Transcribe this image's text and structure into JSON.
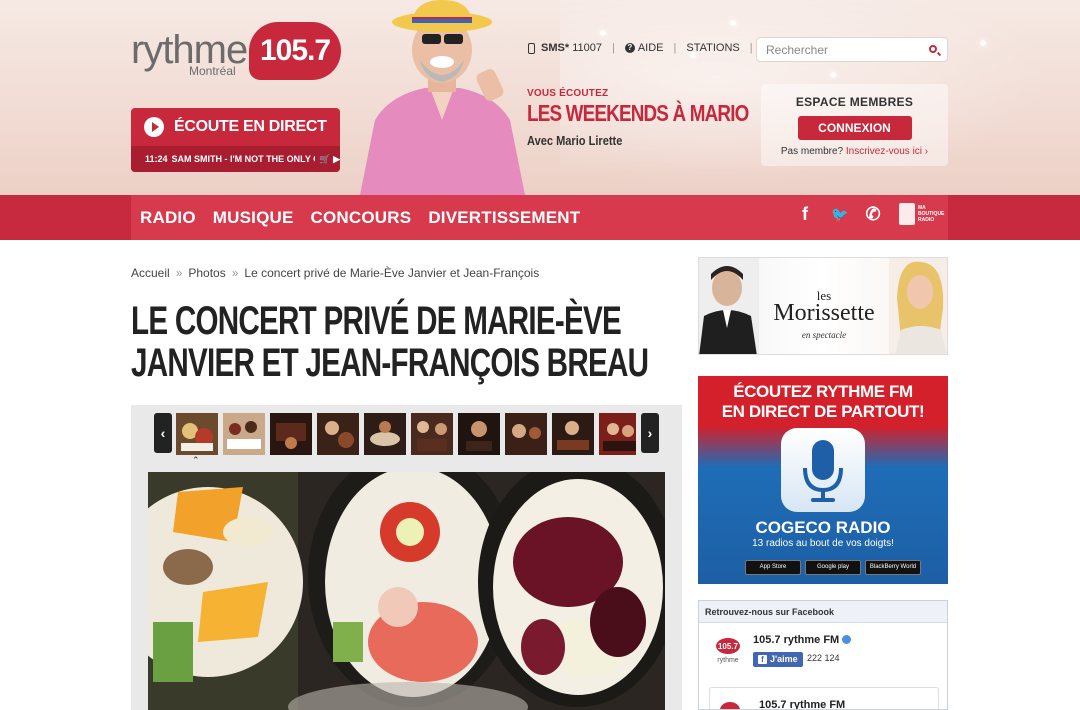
{
  "header": {
    "logo": {
      "word": "rythme",
      "city": "Montréal",
      "frequency": "105.7"
    },
    "listen_live": {
      "label": "ÉCOUTE EN DIRECT",
      "now_playing_time": "11:24",
      "now_playing_track": "SAM SMITH - I'M NOT THE ONLY ONE",
      "icons": "🛒 ▶"
    },
    "show": {
      "kicker": "VOUS ÉCOUTEZ",
      "title": "LES WEEKENDS À MARIO",
      "host": "Avec Mario Lirette"
    },
    "top_links": {
      "sms_label": "SMS*",
      "sms_number": "11007",
      "help": "AIDE",
      "stations": "STATIONS"
    },
    "search": {
      "placeholder": "Rechercher"
    },
    "members": {
      "title": "ESPACE MEMBRES",
      "login_button": "CONNEXION",
      "prompt": "Pas membre?",
      "signup_link": "Inscrivez-vous ici ›"
    }
  },
  "nav": {
    "items": [
      "RADIO",
      "MUSIQUE",
      "CONCOURS",
      "DIVERTISSEMENT"
    ],
    "social": {
      "facebook": "f",
      "twitter": "🐦",
      "phone": "✆"
    },
    "shop_label": "MA BOUTIQUE RADIO"
  },
  "breadcrumb": {
    "home": "Accueil",
    "section": "Photos",
    "current": "Le concert privé de Marie-Ève Janvier et Jean-François"
  },
  "article": {
    "title": "Le concert privé de Marie-Ève Janvier et Jean-François Breau"
  },
  "gallery": {
    "prev": "‹",
    "next": "›",
    "caret": "⌃"
  },
  "sidebar": {
    "ad_morissette": {
      "small": "les",
      "title": "Morissette",
      "subtitle": "en spectacle"
    },
    "ad_cogeco": {
      "headline_1": "ÉCOUTEZ RYTHME FM",
      "headline_2": "EN DIRECT DE PARTOUT!",
      "brand": "COGECO RADIO",
      "tagline": "13 radios au bout de vos doigts!",
      "stores": [
        "App Store",
        "Google play",
        "BlackBerry World"
      ]
    },
    "facebook": {
      "header": "Retrouvez-nous sur Facebook",
      "page_name": "105.7 rythme FM",
      "like_label": "J'aime",
      "like_count": "222 124",
      "post_name": "105.7 rythme FM"
    }
  },
  "colors": {
    "brand_red": "#c8283c",
    "nav_red": "#d83a4d",
    "facebook_blue": "#4267b2"
  }
}
